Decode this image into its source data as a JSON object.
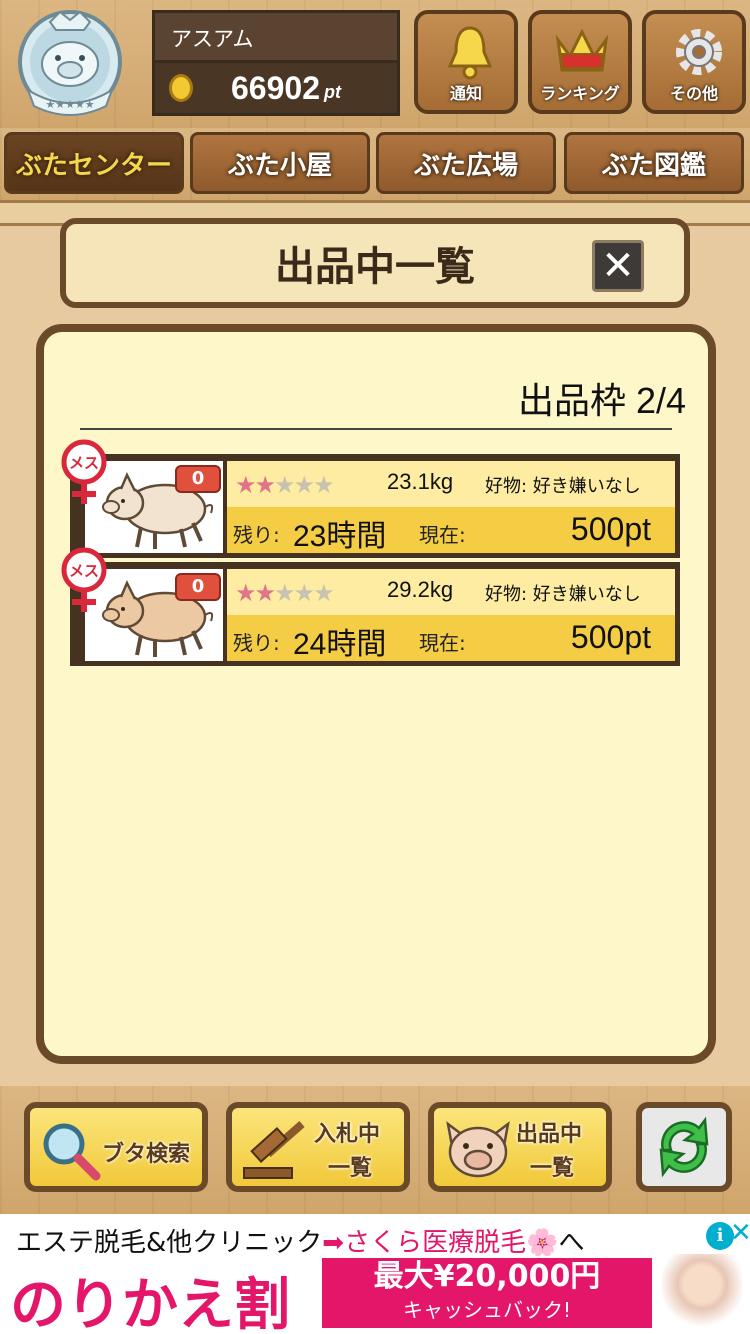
{
  "header": {
    "username": "アスアム",
    "points_value": "66902",
    "points_unit": "pt",
    "buttons": [
      {
        "label": "通知",
        "icon": "bell-icon"
      },
      {
        "label": "ランキング",
        "icon": "crown-icon"
      },
      {
        "label": "その他",
        "icon": "gear-icon"
      }
    ]
  },
  "tabs": [
    "ぶたセンター",
    "ぶた小屋",
    "ぶた広場",
    "ぶた図鑑"
  ],
  "dialog": {
    "title": "出品中一覧",
    "close_label": "✕",
    "slot_label": "出品枠 2/4"
  },
  "listings": [
    {
      "gender": "メス",
      "badge_count": "0",
      "stars_on": 2,
      "stars_total": 5,
      "weight": "23.1kg",
      "preference": "好物: 好き嫌いなし",
      "remaining_label": "残り:",
      "remaining_value": "23時間",
      "current_label": "現在:",
      "current_value": "500pt"
    },
    {
      "gender": "メス",
      "badge_count": "0",
      "stars_on": 2,
      "stars_total": 5,
      "weight": "29.2kg",
      "preference": "好物: 好き嫌いなし",
      "remaining_label": "残り:",
      "remaining_value": "24時間",
      "current_label": "現在:",
      "current_value": "500pt"
    }
  ],
  "bottom_buttons": {
    "search": "ブタ検索",
    "bidding_line1": "入札中",
    "bidding_line2": "一覧",
    "listing_line1": "出品中",
    "listing_line2": "一覧"
  },
  "ad": {
    "line1_a": "エステ脱毛&他クリニック",
    "line1_accent": "➡さくら医療脱毛🌸",
    "line1_b": "へ",
    "headline": "のりかえ割",
    "promo_line1": "最大¥20,000円",
    "promo_line2": "キャッシュバック!"
  },
  "colors": {
    "accent_pink": "#e3166a",
    "gold": "#f4cd45",
    "wood_dark": "#6b4a2a"
  }
}
